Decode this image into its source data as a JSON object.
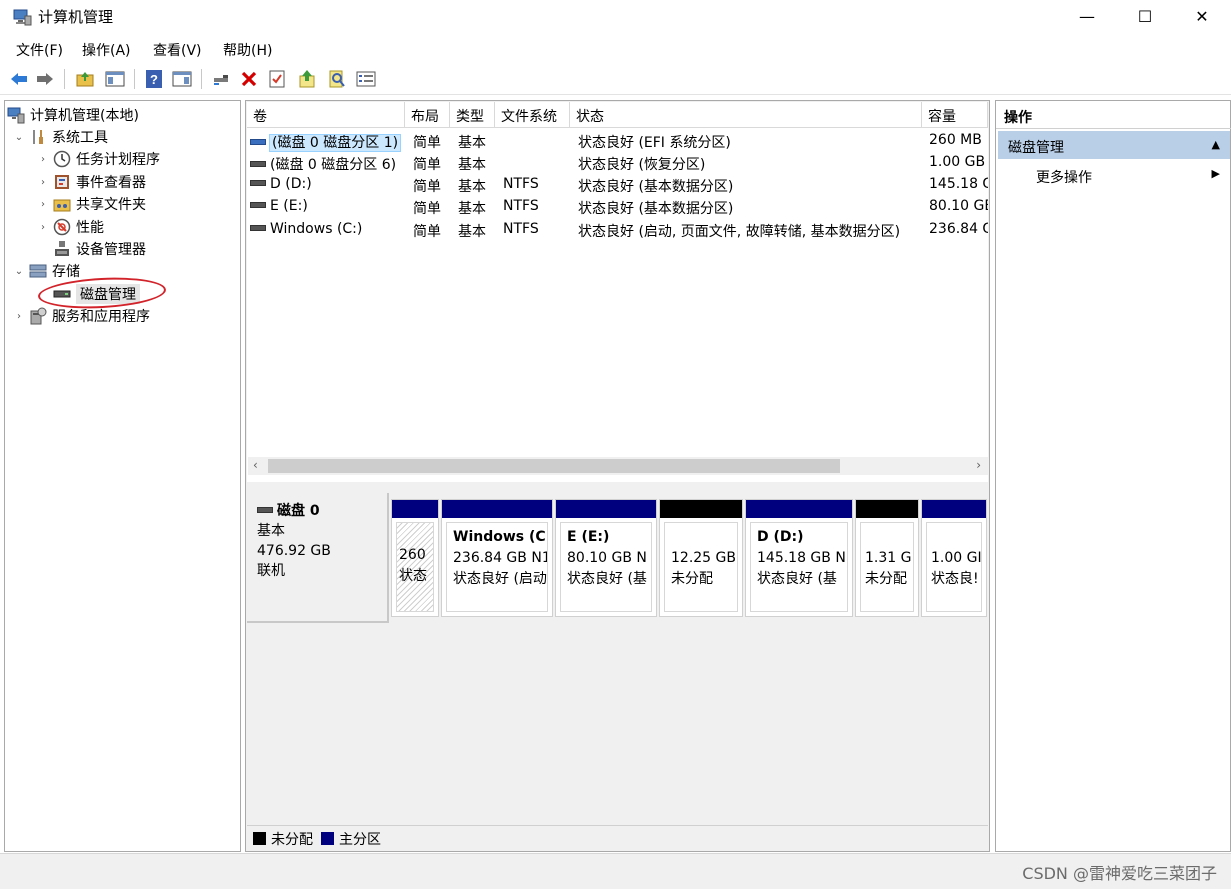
{
  "window": {
    "title": "计算机管理",
    "controls": {
      "minimize": "—",
      "maximize": "☐",
      "close": "✕"
    }
  },
  "menu": [
    "文件(F)",
    "操作(A)",
    "查看(V)",
    "帮助(H)"
  ],
  "toolbar": [
    "back-icon",
    "forward-icon",
    "up-folder-icon",
    "show-hide-tree-icon",
    "help-icon",
    "show-action-pane-icon",
    "connect-icon",
    "delete-icon",
    "properties-icon",
    "import-icon",
    "search-icon",
    "list-icon"
  ],
  "tree": {
    "root": "计算机管理(本地)",
    "system_tools": "系统工具",
    "task_scheduler": "任务计划程序",
    "event_viewer": "事件查看器",
    "shared_folders": "共享文件夹",
    "performance": "性能",
    "device_manager": "设备管理器",
    "storage": "存储",
    "disk_management": "磁盘管理",
    "services_apps": "服务和应用程序"
  },
  "volumes": {
    "headers": [
      "卷",
      "布局",
      "类型",
      "文件系统",
      "状态",
      "容量"
    ],
    "rows": [
      {
        "volume": "(磁盘 0 磁盘分区 1)",
        "layout": "简单",
        "type": "基本",
        "fs": "",
        "status": "状态良好 (EFI 系统分区)",
        "capacity": "260 MB"
      },
      {
        "volume": "(磁盘 0 磁盘分区 6)",
        "layout": "简单",
        "type": "基本",
        "fs": "",
        "status": "状态良好 (恢复分区)",
        "capacity": "1.00 GB"
      },
      {
        "volume": "D (D:)",
        "layout": "简单",
        "type": "基本",
        "fs": "NTFS",
        "status": "状态良好 (基本数据分区)",
        "capacity": "145.18 G"
      },
      {
        "volume": "E (E:)",
        "layout": "简单",
        "type": "基本",
        "fs": "NTFS",
        "status": "状态良好 (基本数据分区)",
        "capacity": "80.10 GE"
      },
      {
        "volume": "Windows (C:)",
        "layout": "简单",
        "type": "基本",
        "fs": "NTFS",
        "status": "状态良好 (启动, 页面文件, 故障转储, 基本数据分区)",
        "capacity": "236.84 G"
      }
    ]
  },
  "disk": {
    "name": "磁盘 0",
    "type": "基本",
    "size": "476.92 GB",
    "state": "联机",
    "partitions": [
      {
        "name": "",
        "size": "260",
        "status": "状态",
        "bar": "#00007f"
      },
      {
        "name": "Windows  (C",
        "size": "236.84 GB N1",
        "status": "状态良好 (启动",
        "bar": "#00007f"
      },
      {
        "name": "E  (E:)",
        "size": "80.10 GB N",
        "status": "状态良好 (基",
        "bar": "#00007f"
      },
      {
        "name": "",
        "size": "12.25 GB",
        "status": "未分配",
        "bar": "#000000"
      },
      {
        "name": "D  (D:)",
        "size": "145.18 GB N",
        "status": "状态良好 (基",
        "bar": "#00007f"
      },
      {
        "name": "",
        "size": "1.31 G",
        "status": "未分配",
        "bar": "#000000"
      },
      {
        "name": "",
        "size": "1.00 GI",
        "status": "状态良!",
        "bar": "#00007f"
      }
    ]
  },
  "legend": [
    {
      "label": "未分配",
      "color": "#000000"
    },
    {
      "label": "主分区",
      "color": "#00007f"
    }
  ],
  "actions": {
    "title": "操作",
    "section": "磁盘管理",
    "more": "更多操作"
  },
  "watermark": "CSDN @雷神爱吃三菜团子"
}
